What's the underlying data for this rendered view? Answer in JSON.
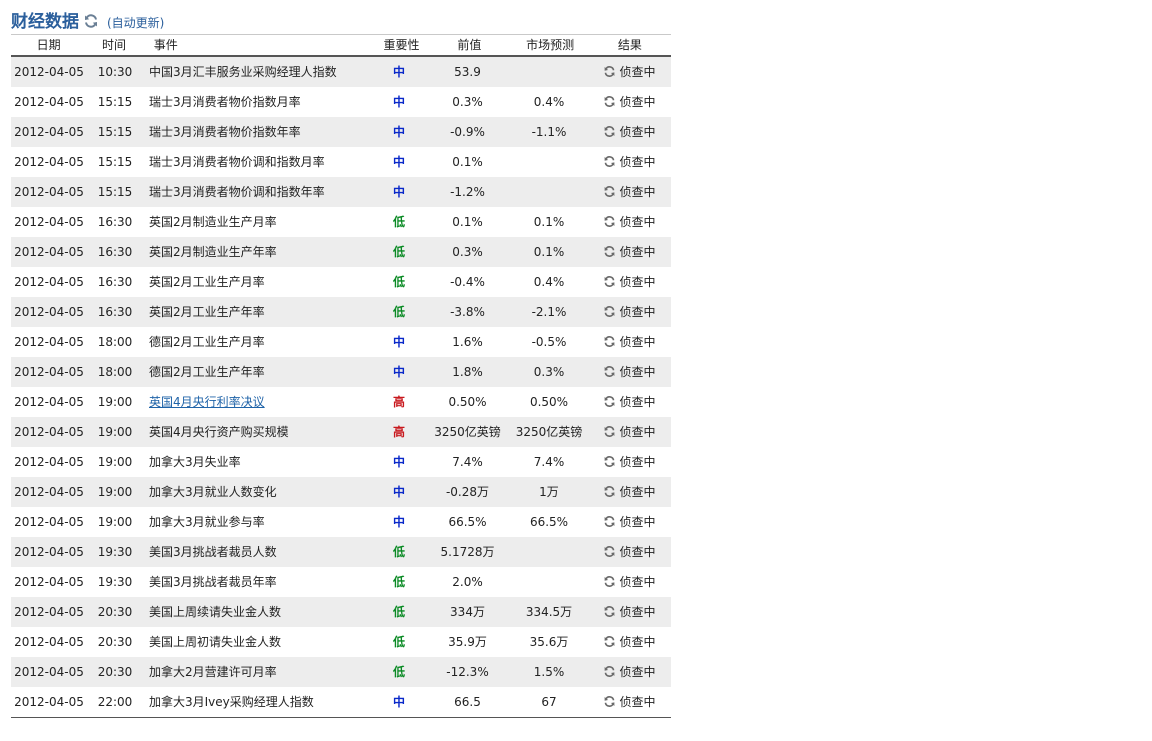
{
  "header": {
    "title": "财经数据",
    "auto_update": "(自动更新)",
    "refresh_icon": "refresh-icon"
  },
  "columns": {
    "date": "日期",
    "time": "时间",
    "event": "事件",
    "importance": "重要性",
    "previous": "前值",
    "forecast": "市场预测",
    "result": "结果"
  },
  "colors": {
    "title": "#2b5f9c",
    "mid": "#0a29c9",
    "low": "#0a8a24",
    "high": "#c8191e",
    "stripe": "#ededed"
  },
  "rows": [
    {
      "date": "2012-04-05",
      "time": "10:30",
      "event": "中国3月汇丰服务业采购经理人指数",
      "importance": "中",
      "level": "mid",
      "previous": "53.9",
      "forecast": "",
      "result": "侦查中"
    },
    {
      "date": "2012-04-05",
      "time": "15:15",
      "event": "瑞士3月消费者物价指数月率",
      "importance": "中",
      "level": "mid",
      "previous": "0.3%",
      "forecast": "0.4%",
      "result": "侦查中"
    },
    {
      "date": "2012-04-05",
      "time": "15:15",
      "event": "瑞士3月消费者物价指数年率",
      "importance": "中",
      "level": "mid",
      "previous": "-0.9%",
      "forecast": "-1.1%",
      "result": "侦查中"
    },
    {
      "date": "2012-04-05",
      "time": "15:15",
      "event": "瑞士3月消费者物价调和指数月率",
      "importance": "中",
      "level": "mid",
      "previous": "0.1%",
      "forecast": "",
      "result": "侦查中"
    },
    {
      "date": "2012-04-05",
      "time": "15:15",
      "event": "瑞士3月消费者物价调和指数年率",
      "importance": "中",
      "level": "mid",
      "previous": "-1.2%",
      "forecast": "",
      "result": "侦查中"
    },
    {
      "date": "2012-04-05",
      "time": "16:30",
      "event": "英国2月制造业生产月率",
      "importance": "低",
      "level": "low",
      "previous": "0.1%",
      "forecast": "0.1%",
      "result": "侦查中"
    },
    {
      "date": "2012-04-05",
      "time": "16:30",
      "event": "英国2月制造业生产年率",
      "importance": "低",
      "level": "low",
      "previous": "0.3%",
      "forecast": "0.1%",
      "result": "侦查中"
    },
    {
      "date": "2012-04-05",
      "time": "16:30",
      "event": "英国2月工业生产月率",
      "importance": "低",
      "level": "low",
      "previous": "-0.4%",
      "forecast": "0.4%",
      "result": "侦查中"
    },
    {
      "date": "2012-04-05",
      "time": "16:30",
      "event": "英国2月工业生产年率",
      "importance": "低",
      "level": "low",
      "previous": "-3.8%",
      "forecast": "-2.1%",
      "result": "侦查中"
    },
    {
      "date": "2012-04-05",
      "time": "18:00",
      "event": "德国2月工业生产月率",
      "importance": "中",
      "level": "mid",
      "previous": "1.6%",
      "forecast": "-0.5%",
      "result": "侦查中"
    },
    {
      "date": "2012-04-05",
      "time": "18:00",
      "event": "德国2月工业生产年率",
      "importance": "中",
      "level": "mid",
      "previous": "1.8%",
      "forecast": "0.3%",
      "result": "侦查中"
    },
    {
      "date": "2012-04-05",
      "time": "19:00",
      "event": "英国4月央行利率决议",
      "importance": "高",
      "level": "high",
      "link": true,
      "previous": "0.50%",
      "forecast": "0.50%",
      "result": "侦查中"
    },
    {
      "date": "2012-04-05",
      "time": "19:00",
      "event": "英国4月央行资产购买规模",
      "importance": "高",
      "level": "high",
      "previous": "3250亿英镑",
      "forecast": "3250亿英镑",
      "result": "侦查中"
    },
    {
      "date": "2012-04-05",
      "time": "19:00",
      "event": "加拿大3月失业率",
      "importance": "中",
      "level": "mid",
      "previous": "7.4%",
      "forecast": "7.4%",
      "result": "侦查中"
    },
    {
      "date": "2012-04-05",
      "time": "19:00",
      "event": "加拿大3月就业人数变化",
      "importance": "中",
      "level": "mid",
      "previous": "-0.28万",
      "forecast": "1万",
      "result": "侦查中"
    },
    {
      "date": "2012-04-05",
      "time": "19:00",
      "event": "加拿大3月就业参与率",
      "importance": "中",
      "level": "mid",
      "previous": "66.5%",
      "forecast": "66.5%",
      "result": "侦查中"
    },
    {
      "date": "2012-04-05",
      "time": "19:30",
      "event": "美国3月挑战者裁员人数",
      "importance": "低",
      "level": "low",
      "previous": "5.1728万",
      "forecast": "",
      "result": "侦查中"
    },
    {
      "date": "2012-04-05",
      "time": "19:30",
      "event": "美国3月挑战者裁员年率",
      "importance": "低",
      "level": "low",
      "previous": "2.0%",
      "forecast": "",
      "result": "侦查中"
    },
    {
      "date": "2012-04-05",
      "time": "20:30",
      "event": "美国上周续请失业金人数",
      "importance": "低",
      "level": "low",
      "previous": "334万",
      "forecast": "334.5万",
      "result": "侦查中"
    },
    {
      "date": "2012-04-05",
      "time": "20:30",
      "event": "美国上周初请失业金人数",
      "importance": "低",
      "level": "low",
      "previous": "35.9万",
      "forecast": "35.6万",
      "result": "侦查中"
    },
    {
      "date": "2012-04-05",
      "time": "20:30",
      "event": "加拿大2月营建许可月率",
      "importance": "低",
      "level": "low",
      "previous": "-12.3%",
      "forecast": "1.5%",
      "result": "侦查中"
    },
    {
      "date": "2012-04-05",
      "time": "22:00",
      "event": "加拿大3月Ivey采购经理人指数",
      "importance": "中",
      "level": "mid",
      "previous": "66.5",
      "forecast": "67",
      "result": "侦查中"
    }
  ]
}
